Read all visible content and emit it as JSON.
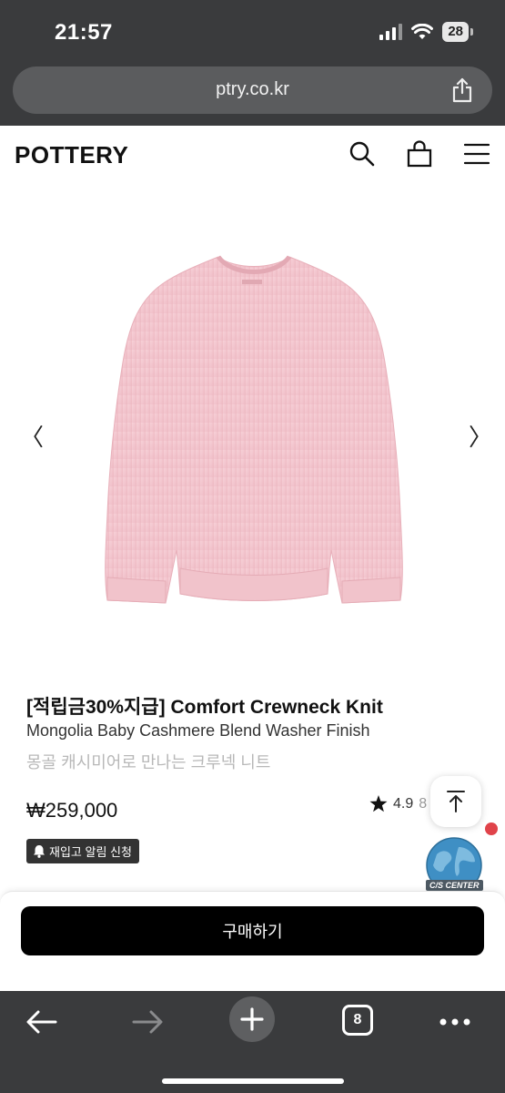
{
  "status_bar": {
    "time": "21:57",
    "battery": "28"
  },
  "browser": {
    "url": "ptry.co.kr",
    "tab_count": "8"
  },
  "site": {
    "logo": "POTTERY"
  },
  "product": {
    "title": "[적립금30%지급] Comfort Crewneck Knit",
    "subtitle": "Mongolia Baby Cashmere Blend Washer Finish",
    "description": "몽골 캐시미어로 만나는 크루넥 니트",
    "price": "₩259,000",
    "rating": "4.9",
    "rating_extra": "8",
    "restock_notify": "재입고 알림 신청",
    "image_color": "#f3c7cf"
  },
  "floating": {
    "cs_center": "C/S CENTER"
  },
  "purchase": {
    "buy_label": "구매하기"
  },
  "colors": {
    "chrome": "#3a3b3d",
    "buy_button": "#000000",
    "notify_dot": "#e0434a"
  }
}
